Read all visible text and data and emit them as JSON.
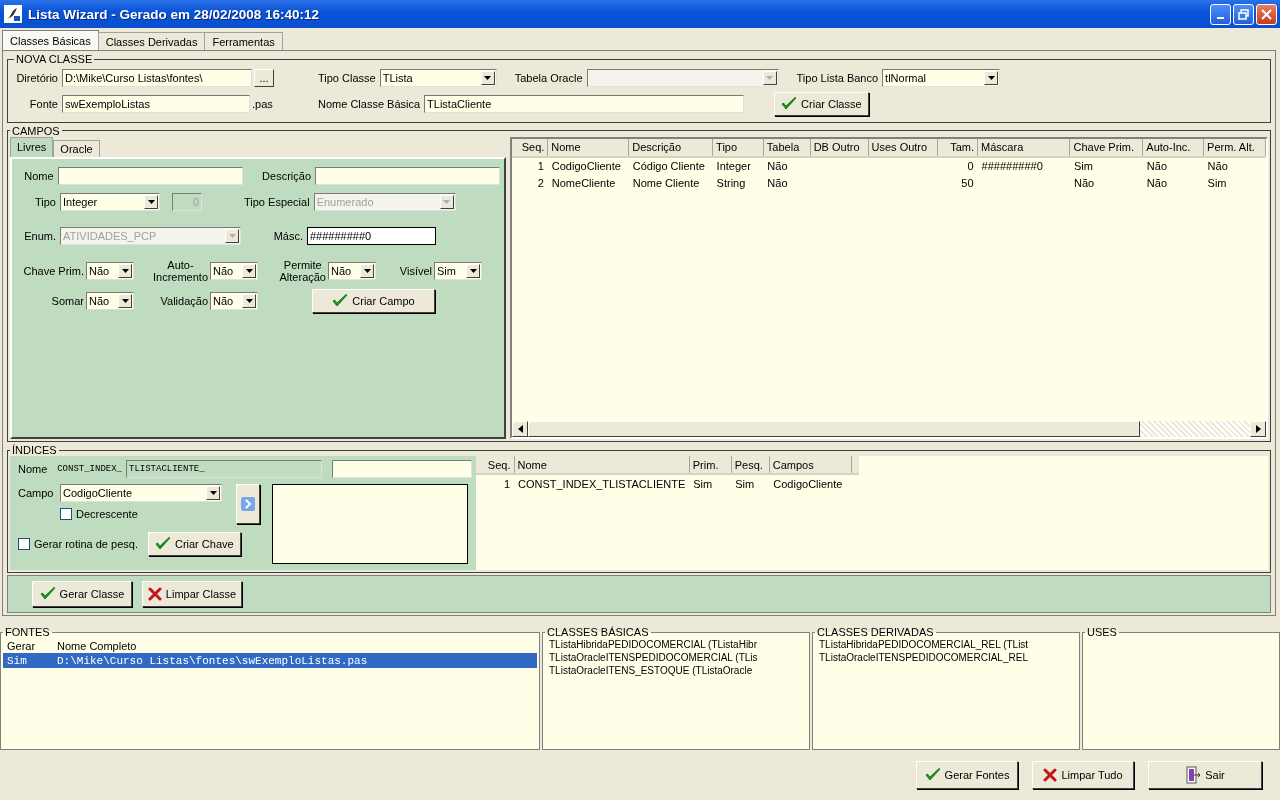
{
  "window": {
    "title": "Lista Wizard - Gerado em 28/02/2008 16:40:12"
  },
  "tabs": [
    {
      "label": "Classes Básicas",
      "selected": true
    },
    {
      "label": "Classes Derivadas",
      "selected": false
    },
    {
      "label": "Ferramentas",
      "selected": false
    }
  ],
  "nova_classe": {
    "legend": "NOVA CLASSE",
    "diretorio": {
      "label": "Diretório",
      "value": "D:\\Mike\\Curso Listas\\fontes\\",
      "browse": "..."
    },
    "tipo_classe": {
      "label": "Tipo Classe",
      "value": "TLista"
    },
    "tabela_oracle": {
      "label": "Tabela Oracle",
      "disabled": true
    },
    "tipo_lista_banco": {
      "label": "Tipo Lista Banco",
      "value": "tlNormal"
    },
    "fonte": {
      "label": "Fonte",
      "value": "swExemploListas",
      "suffix": ".pas"
    },
    "nome_classe_basica": {
      "label": "Nome Classe Básica",
      "value": "TListaCliente"
    },
    "button": "Criar Classe"
  },
  "campos": {
    "legend": "CAMPOS",
    "tabs": [
      {
        "label": "Livres",
        "selected": true
      },
      {
        "label": "Oracle",
        "selected": false
      }
    ],
    "form": {
      "nome": {
        "label": "Nome"
      },
      "descricao": {
        "label": "Descrição"
      },
      "tipo": {
        "label": "Tipo",
        "value": "Integer"
      },
      "tamanho": {
        "value": "0",
        "disabled": true
      },
      "tipo_especial": {
        "label": "Tipo Especial",
        "value": "Enumerado",
        "disabled": true
      },
      "enum": {
        "label": "Enum.",
        "value": "ATIVIDADES_PCP",
        "disabled": true
      },
      "mascara": {
        "label": "Másc.",
        "value": "#########0"
      },
      "flags": [
        {
          "label": "Chave Prim.",
          "value": "Não"
        },
        {
          "label": "Auto-\nIncremento",
          "value": "Não"
        },
        {
          "label": "Permite\nAlteração",
          "value": "Não"
        },
        {
          "label": "Visível",
          "value": "Sim"
        },
        {
          "label": "Somar",
          "value": "Não"
        },
        {
          "label": "Validação",
          "value": "Não"
        }
      ],
      "button": "Criar Campo"
    },
    "grid": {
      "columns": [
        {
          "label": "Seq.",
          "numeric": true
        },
        {
          "label": "Nome",
          "numeric": false
        },
        {
          "label": "Descrição",
          "numeric": false
        },
        {
          "label": "Tipo",
          "numeric": false
        },
        {
          "label": "Tabela",
          "numeric": false
        },
        {
          "label": "DB Outro",
          "numeric": false
        },
        {
          "label": "Uses Outro",
          "numeric": false
        },
        {
          "label": "Tam.",
          "numeric": true
        },
        {
          "label": "Máscara",
          "numeric": false
        },
        {
          "label": "Chave Prim.",
          "numeric": false
        },
        {
          "label": "Auto-Inc.",
          "numeric": false
        },
        {
          "label": "Perm. Alt.",
          "numeric": false
        }
      ],
      "rows": [
        [
          "1",
          "CodigoCliente",
          "Código Cliente",
          "Integer",
          "Não",
          "",
          "",
          "0",
          "#########0",
          "Sim",
          "Não",
          "Não"
        ],
        [
          "2",
          "NomeCliente",
          "Nome Cliente",
          "String",
          "Não",
          "",
          "",
          "50",
          "",
          "Não",
          "Não",
          "Sim"
        ]
      ]
    }
  },
  "indices": {
    "legend": "ÍNDICES",
    "nome": {
      "label": "Nome",
      "prefix": "CONST_INDEX_",
      "value": "TLISTACLIENTE_"
    },
    "campo": {
      "label": "Campo",
      "value": "CodigoCliente"
    },
    "decrescente": {
      "label": "Decrescente",
      "checked": false
    },
    "gerar_rotina": {
      "label": "Gerar rotina de pesq.",
      "checked": false
    },
    "button": "Criar Chave",
    "grid": {
      "columns": [
        {
          "label": "Seq.",
          "numeric": true
        },
        {
          "label": "Nome",
          "numeric": false
        },
        {
          "label": "Prim.",
          "numeric": false
        },
        {
          "label": "Pesq.",
          "numeric": false
        },
        {
          "label": "Campos",
          "numeric": false
        }
      ],
      "rows": [
        [
          "1",
          "CONST_INDEX_TLISTACLIENTE",
          "Sim",
          "Sim",
          "CodigoCliente"
        ]
      ]
    }
  },
  "actions": [
    {
      "label": "Gerar Classe",
      "kind": "check"
    },
    {
      "label": "Limpar Classe",
      "kind": "cross"
    }
  ],
  "fontes": {
    "legend": "FONTES",
    "columns": [
      "Gerar",
      "Nome Completo"
    ],
    "rows": [
      {
        "cells": [
          "Sim",
          "D:\\Mike\\Curso Listas\\fontes\\swExemploListas.pas"
        ],
        "selected": true
      }
    ]
  },
  "classes_basicas": {
    "legend": "CLASSES BÁSICAS",
    "items": [
      "TListaHibridaPEDIDOCOMERCIAL  (TListaHibr",
      "TListaOracleITENSPEDIDOCOMERCIAL  (TLis",
      "TListaOracleITENS_ESTOQUE  (TListaOracle"
    ]
  },
  "classes_derivadas": {
    "legend": "CLASSES DERIVADAS",
    "items": [
      "TListaHibridaPEDIDOCOMERCIAL_REL  (TList",
      "TListaOracleITENSPEDIDOCOMERCIAL_REL"
    ]
  },
  "uses": {
    "legend": "USES"
  },
  "footer_buttons": [
    {
      "label": "Gerar Fontes",
      "kind": "check"
    },
    {
      "label": "Limpar Tudo",
      "kind": "cross"
    },
    {
      "label": "Sair",
      "kind": "exit"
    }
  ]
}
